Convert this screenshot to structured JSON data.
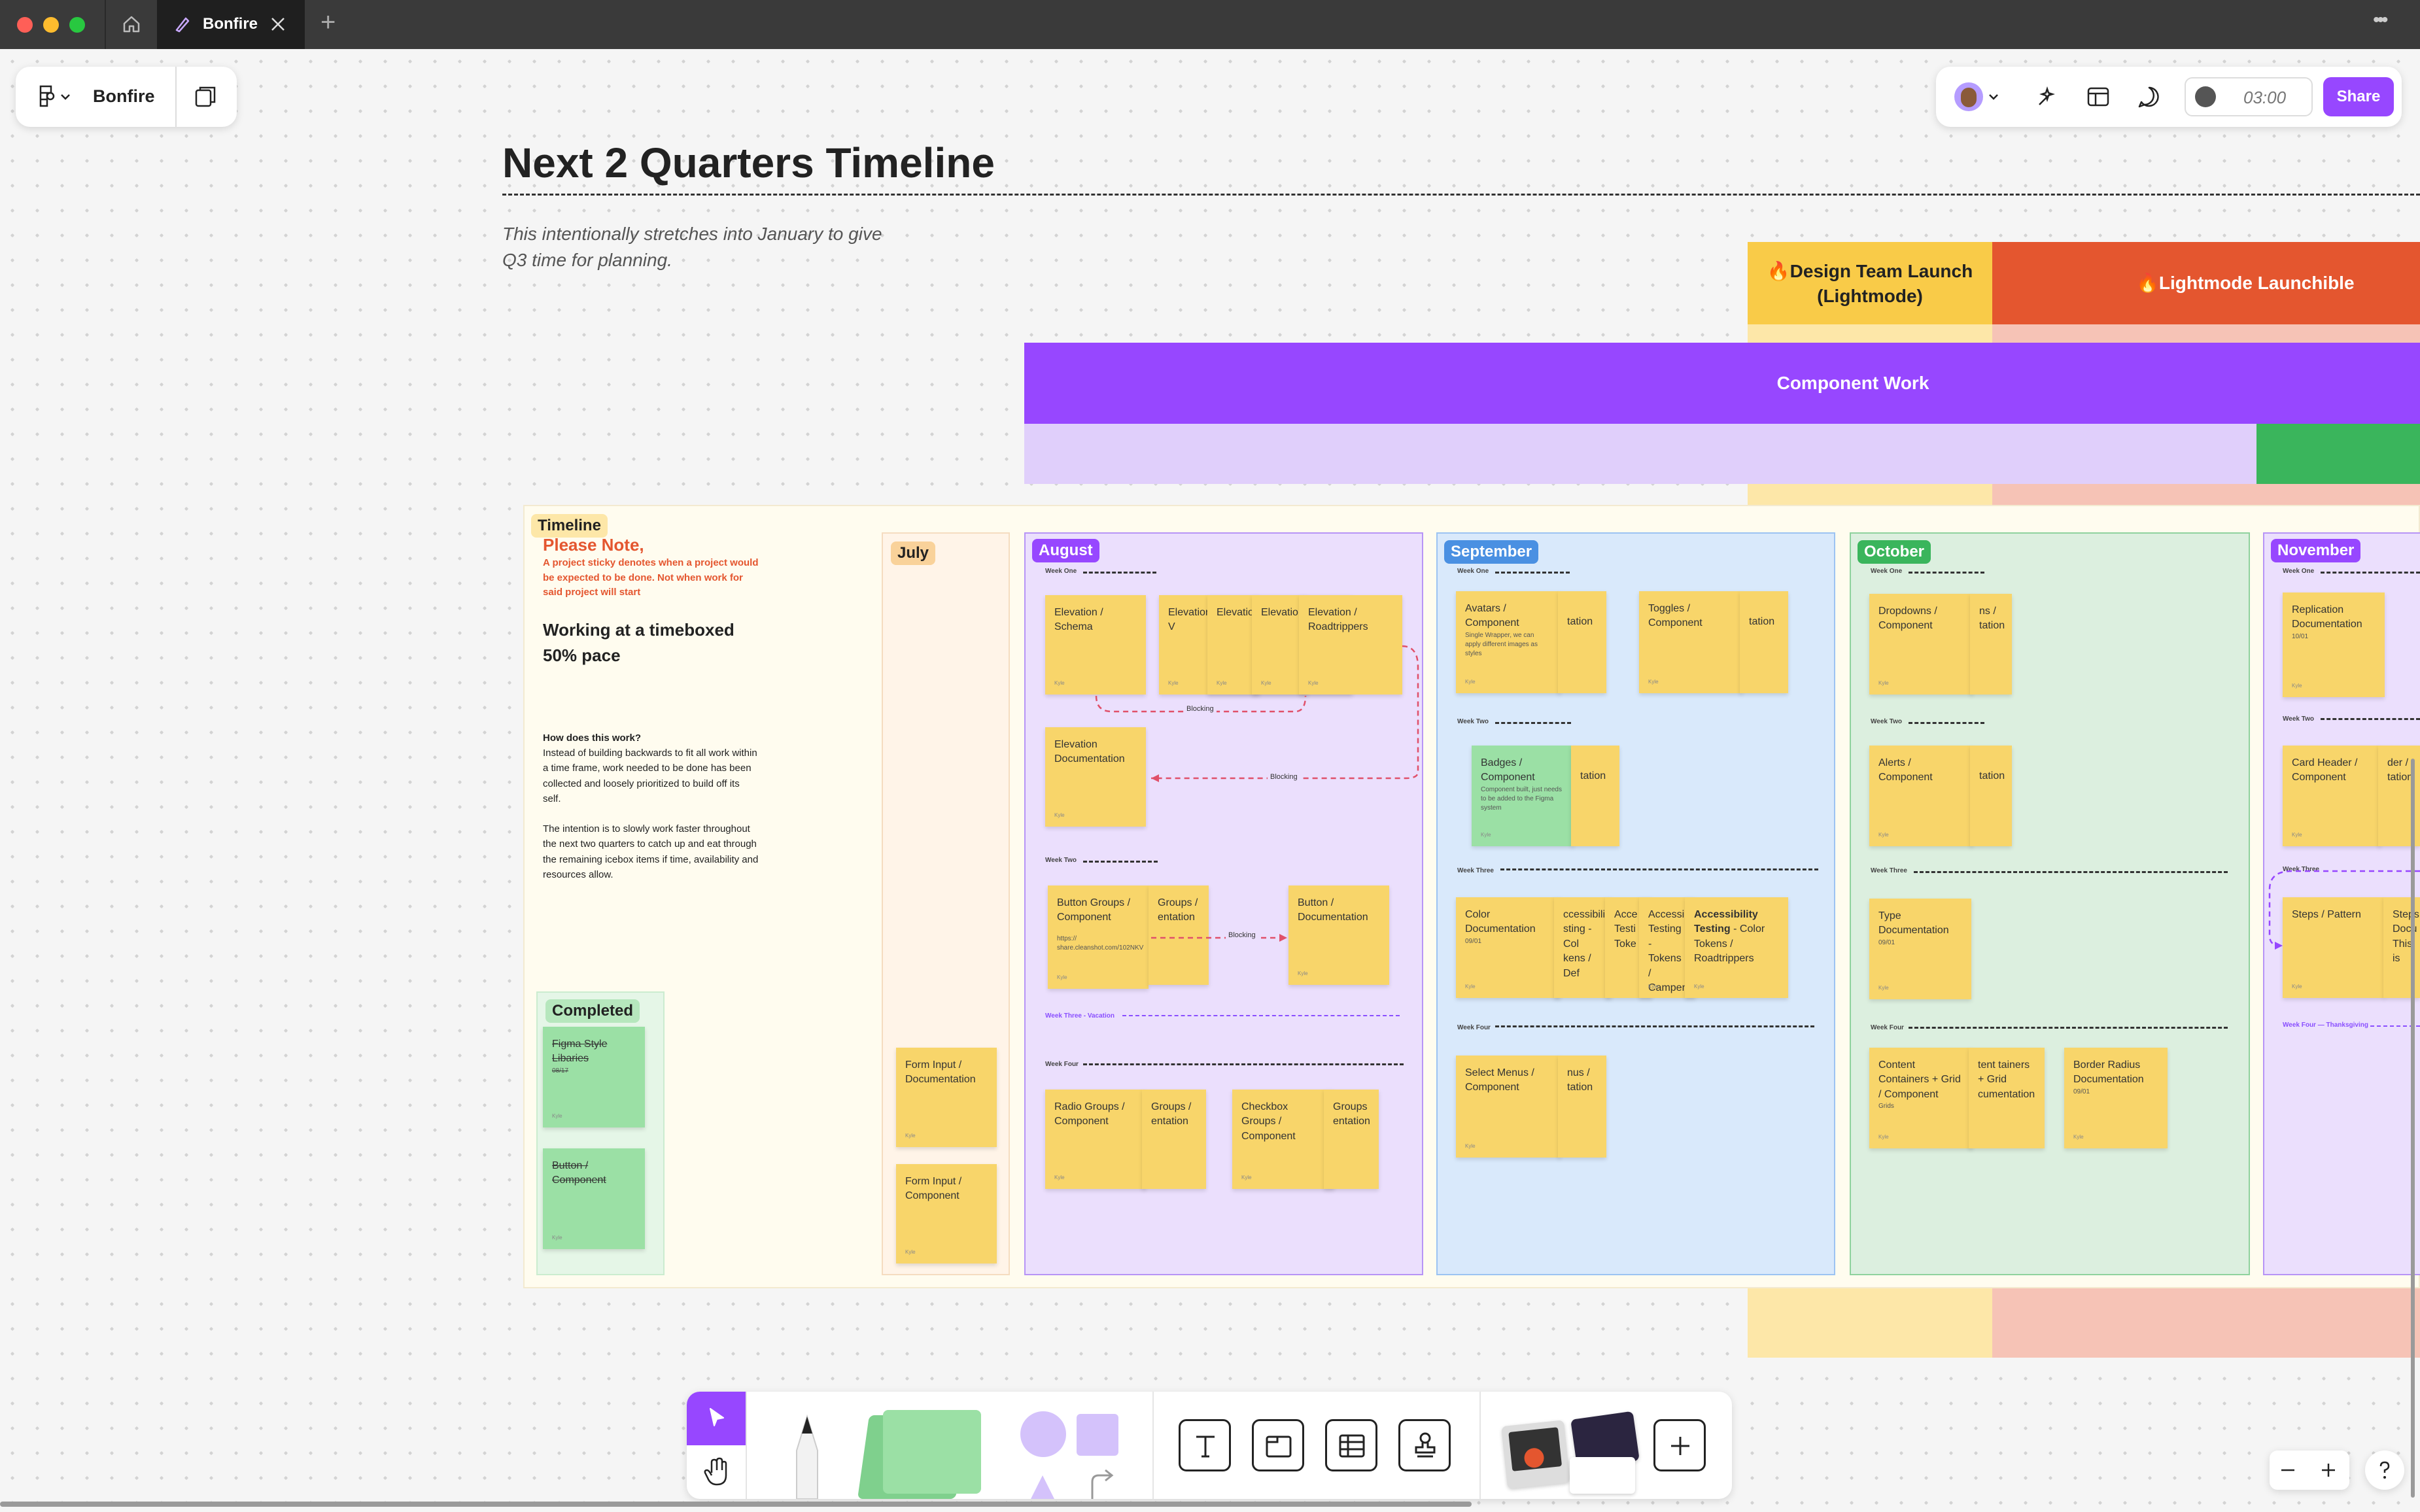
{
  "tabs": {
    "active_label": "Bonfire",
    "new_tab": "+",
    "menu": "•••"
  },
  "file": {
    "name": "Bonfire"
  },
  "toolbar": {
    "timer": "03:00",
    "share": "Share"
  },
  "board": {
    "title": "Next 2 Quarters Timeline",
    "subtitle_line1": "This intentionally stretches into January to give",
    "subtitle_line2": "Q3 time for planning.",
    "launch_design": "🔥Design Team Launch (Lightmode)",
    "launch_lightmode": "🔥Lightmode Launchible",
    "component_work": "Component Work"
  },
  "timeline": {
    "label": "Timeline",
    "note_title": "Please Note,",
    "note_body": "A project sticky denotes when a project would be expected to be done. Not when work for said project will start",
    "pace": "Working at a timeboxed 50% pace",
    "how_title": "How does this work?",
    "how_p1": "Instead of building backwards to fit all work within a time frame, work needed to be done has been collected and loosely prioritized to build off its self.",
    "how_p2": "The intention is to slowly work faster throughout the next two quarters to catch up and eat through the remaining icebox items if time, availability and resources allow.",
    "completed": "Completed",
    "completed_items": [
      "Figma Style Libaries",
      "Button / Component"
    ],
    "completed_date": "08/17"
  },
  "months": {
    "july": "July",
    "august": "August",
    "september": "September",
    "october": "October",
    "november": "November"
  },
  "weeks": {
    "one": "Week One",
    "two": "Week Two",
    "three": "Week Three",
    "four": "Week Four",
    "three_vacation": "Week Three - Vacation",
    "four_thanksgiving": "Week Four — Thanksgiving"
  },
  "blocking": "Blocking",
  "author": "Kyle",
  "july_stickies": [
    "Form Input / Documentation",
    "Form Input / Component"
  ],
  "august_stickies": {
    "s1": "Elevation / Schema",
    "s2": "Elevation Default V",
    "s3": "Elevatio RVillage",
    "s4": "Elevatio Campen",
    "s5": "Elevation / Roadtrippers",
    "s6": "Elevation Documentation",
    "s7": "Button Groups / Component",
    "s7_link": "https:// share.cleanshot.com/102NKV",
    "s8": "Groups / entation",
    "s9": "Button / Documentation",
    "s10": "Radio Groups / Component",
    "s11": "Groups / entation",
    "s12": "Checkbox Groups / Component",
    "s13": "Groups entation"
  },
  "september_stickies": {
    "s1": "Avatars / Component",
    "s1_note": "Single Wrapper, we can apply different images as styles",
    "s2": "tation",
    "s3": "Toggles / Component",
    "s4": "tation",
    "s5": "Badges / Component",
    "s5_note": "Component built, just needs to be added to the Figma system",
    "s6": "tation",
    "s7": "Color Documentation",
    "s7_date": "09/01",
    "s8": "ccessibility sting - Col kens / Def",
    "s9": "Acce Testi Toke",
    "s10": "Accessi Testing - Tokens / Campen",
    "s11_bold": "Accessibility Testing",
    "s11": "- Color Tokens / Roadtrippers",
    "s12": "Select Menus / Component",
    "s13": "nus / tation"
  },
  "october_stickies": {
    "s1": "Dropdowns / Component",
    "s2": "ns / tation",
    "s3": "Alerts / Component",
    "s4": "tation",
    "s5": "Type Documentation",
    "s5_date": "09/01",
    "s6": "Content Containers + Grid / Component",
    "s6_note": "Grids",
    "s7": "tent tainers + Grid cumentation",
    "s8": "Border Radius Documentation",
    "s8_date": "09/01"
  },
  "november_stickies": {
    "s1": "Replication Documentation",
    "s1_date": "10/01",
    "s2": "Card Header / Component",
    "s3": "der / tation",
    "s4": "Steps / Pattern",
    "s5": "Steps Docu This is"
  },
  "colors": {
    "purple": "#9747ff",
    "orange_red": "#e4562f",
    "yellow": "#f9cb48",
    "sticky": "#f8d56a",
    "green": "#3ab55c",
    "blue": "#4a90e2"
  }
}
